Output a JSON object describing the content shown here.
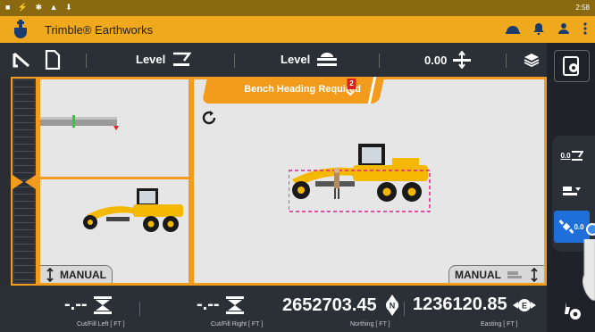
{
  "status": {
    "icons_left": "■ ⚡ ✱ ▲ ⬇",
    "time": "2:58"
  },
  "titlebar": {
    "title": "Trimble® Earthworks"
  },
  "toolbar": {
    "level_left_label": "Level",
    "level_right_label": "Level",
    "offset_value": "0.00"
  },
  "main": {
    "banner_text": "Bench Heading Required",
    "banner_badge": "2",
    "manual_left": "MANUAL",
    "manual_right": "MANUAL"
  },
  "rightrail": {
    "mode_value": "0.0",
    "gps_value": "0.0"
  },
  "bottombar": {
    "cutfill_left_value": "-.--",
    "cutfill_left_label": "Cut/Fill Left  [ FT ]",
    "cutfill_right_value": "-.--",
    "cutfill_right_label": "Cut/Fill Right  [ FT ]",
    "northing_value": "2652703.45",
    "northing_label": "Northing  [ FT ]",
    "easting_value": "1236120.85",
    "easting_label": "Easting  [ FT ]"
  },
  "colors": {
    "accent": "#f39b1d",
    "titlebar": "#f0a81c",
    "dark": "#2b2f36",
    "active_blue": "#1e6fd9"
  }
}
